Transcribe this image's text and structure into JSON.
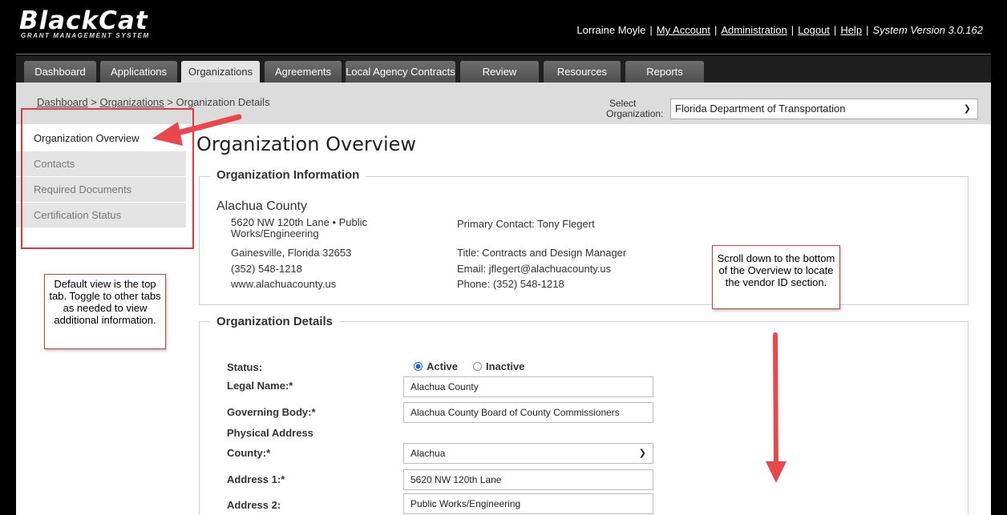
{
  "header": {
    "logo_text": "BlackCat",
    "logo_sub": "GRANT MANAGEMENT SYSTEM",
    "user_name": "Lorraine Moyle",
    "links": [
      "My Account",
      "Administration",
      "Logout",
      "Help"
    ],
    "version": "System Version 3.0.162"
  },
  "tabs": [
    {
      "label": "Dashboard"
    },
    {
      "label": "Applications"
    },
    {
      "label": "Organizations"
    },
    {
      "label": "Agreements"
    },
    {
      "label": "Local Agency Contracts"
    },
    {
      "label": "Review"
    },
    {
      "label": "Resources"
    },
    {
      "label": "Reports"
    }
  ],
  "active_tab": "Organizations",
  "breadcrumb": {
    "items": [
      "Dashboard",
      "Organizations"
    ],
    "current": "Organization Details",
    "separator": ">"
  },
  "org_select": {
    "label_line1": "Select",
    "label_line2": "Organization:",
    "value": "Florida Department of Transportation"
  },
  "sidebar": {
    "items": [
      {
        "label": "Organization Overview"
      },
      {
        "label": "Contacts"
      },
      {
        "label": "Required Documents"
      },
      {
        "label": "Certification Status"
      }
    ]
  },
  "page_title": "Organization Overview",
  "org_info": {
    "legend": "Organization Information",
    "name": "Alachua County",
    "address_line1": "5620 NW 120th Lane • Public",
    "address_line2": "Works/Engineering",
    "city_state_zip": "Gainesville, Florida 32653",
    "phone": "(352) 548-1218",
    "website": "www.alachuacounty.us",
    "primary_contact": "Primary Contact: Tony Flegert",
    "title": "Title: Contracts and Design Manager",
    "email": "Email: jflegert@alachuacounty.us",
    "contact_phone": "Phone: (352) 548-1218"
  },
  "org_details": {
    "legend": "Organization Details",
    "status_label": "Status:",
    "status_options": [
      "Active",
      "Inactive"
    ],
    "status_selected": "Active",
    "legal_name_label": "Legal Name:*",
    "legal_name_value": "Alachua County",
    "governing_body_label": "Governing Body:*",
    "governing_body_value": "Alachua County Board of County Commissioners",
    "physical_address_heading": "Physical Address",
    "county_label": "County:*",
    "county_value": "Alachua",
    "address1_label": "Address 1:*",
    "address1_value": "5620 NW 120th Lane",
    "address2_label": "Address 2:",
    "address2_value": "Public Works/Engineering"
  },
  "annotations": {
    "left_note": "Default view is the top tab. Toggle to other tabs as needed to view additional information.",
    "right_note": "Scroll down to the bottom of the Overview to locate the vendor ID section.",
    "color": "#e0393e"
  },
  "colors": {
    "header_bg": "#000000",
    "tab_bg": "#5a5a5a",
    "tab_active_bg": "#e3e3e3",
    "radio_accent": "#1e64d6"
  }
}
